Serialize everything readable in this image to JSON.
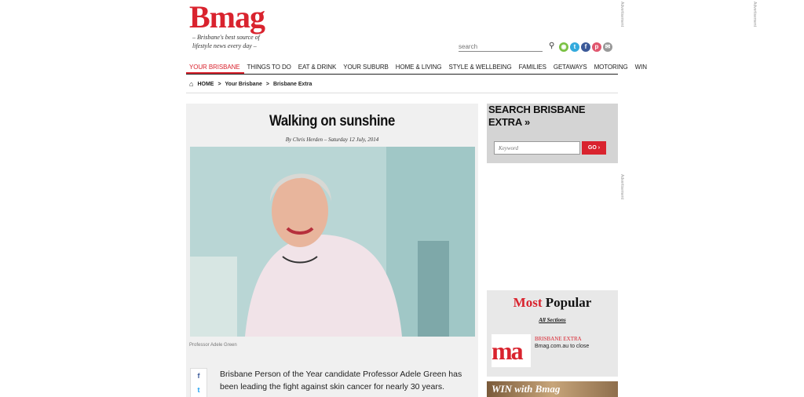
{
  "site": {
    "logo": "Bmag",
    "tagline": "– Brisbane's best source of lifestyle news every day –"
  },
  "header": {
    "search_placeholder": "search",
    "search_icon": "search-icon",
    "social": [
      {
        "name": "rss-icon",
        "glyph": "◉",
        "color": "#7ac143"
      },
      {
        "name": "twitter-icon",
        "glyph": "t",
        "color": "#33aadd"
      },
      {
        "name": "facebook-icon",
        "glyph": "f",
        "color": "#3b5998"
      },
      {
        "name": "pinterest-icon",
        "glyph": "p",
        "color": "#e0566e"
      },
      {
        "name": "email-icon",
        "glyph": "✉",
        "color": "#999999"
      }
    ]
  },
  "nav": {
    "items": [
      "YOUR BRISBANE",
      "THINGS TO DO",
      "EAT & DRINK",
      "YOUR SUBURB",
      "HOME & LIVING",
      "STYLE & WELLBEING",
      "FAMILIES",
      "GETAWAYS",
      "MOTORING",
      "WIN"
    ],
    "active": 0
  },
  "breadcrumb": {
    "home": "HOME",
    "sep": ">",
    "level1": "Your Brisbane",
    "level2": "Brisbane Extra"
  },
  "article": {
    "title": "Walking on sunshine",
    "byline": "By Chris Herden – Saturday 12 July, 2014",
    "caption": "Professor Adele Green",
    "intro": "Brisbane Person of the Year candidate Professor Adele Green has been leading the fight against skin cancer for nearly 30 years.",
    "share_facebook": "f",
    "share_twitter": "t"
  },
  "sidebar": {
    "search_title": "SEARCH BRISBANE EXTRA »",
    "keyword_placeholder": "Keyword",
    "go_label": "GO ›",
    "most_popular": {
      "most": "Most",
      "popular": "Popular",
      "sections": "All Sections",
      "thumb_text": "ma",
      "category": "BRISBANE EXTRA",
      "item": "Bmag.com.au to close"
    },
    "win_text": "WIN with Bmag"
  },
  "ads": {
    "label": "Advertisement"
  },
  "colors": {
    "brand_red": "#d9232e"
  }
}
